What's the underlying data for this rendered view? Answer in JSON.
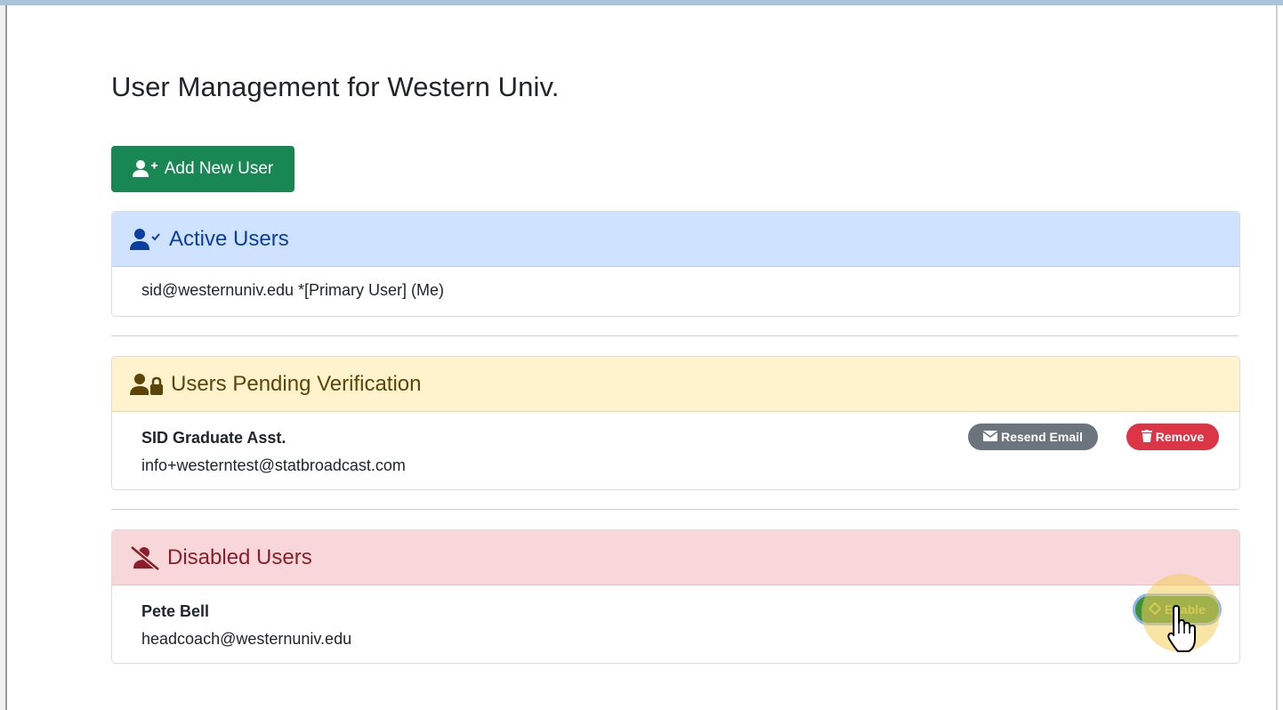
{
  "page": {
    "title": "User Management for Western Univ."
  },
  "toolbar": {
    "add_user_label": "Add New User"
  },
  "active_users": {
    "heading": "Active Users",
    "rows": [
      {
        "text": "sid@westernuniv.edu *[Primary User] (Me)"
      }
    ]
  },
  "pending_users": {
    "heading": "Users Pending Verification",
    "rows": [
      {
        "name": "SID Graduate Asst.",
        "email": "info+westerntest@statbroadcast.com",
        "resend_label": "Resend Email",
        "remove_label": "Remove"
      }
    ]
  },
  "disabled_users": {
    "heading": "Disabled Users",
    "rows": [
      {
        "name": "Pete Bell",
        "email": "headcoach@westernuniv.edu",
        "enable_label": "Enable"
      }
    ]
  },
  "colors": {
    "primary_green": "#198754",
    "active_header_bg": "#cfe2ff",
    "pending_header_bg": "#fff3cd",
    "disabled_header_bg": "#f8d7da",
    "secondary_gray": "#6c757d",
    "danger_red": "#dc3545"
  },
  "icons": {
    "add_user": "user-plus-icon",
    "active": "user-check-icon",
    "pending": "user-lock-icon",
    "disabled": "user-slash-icon",
    "resend": "envelope-icon",
    "remove": "trash-icon",
    "enable": "power-icon",
    "cursor": "hand-pointer-icon"
  }
}
